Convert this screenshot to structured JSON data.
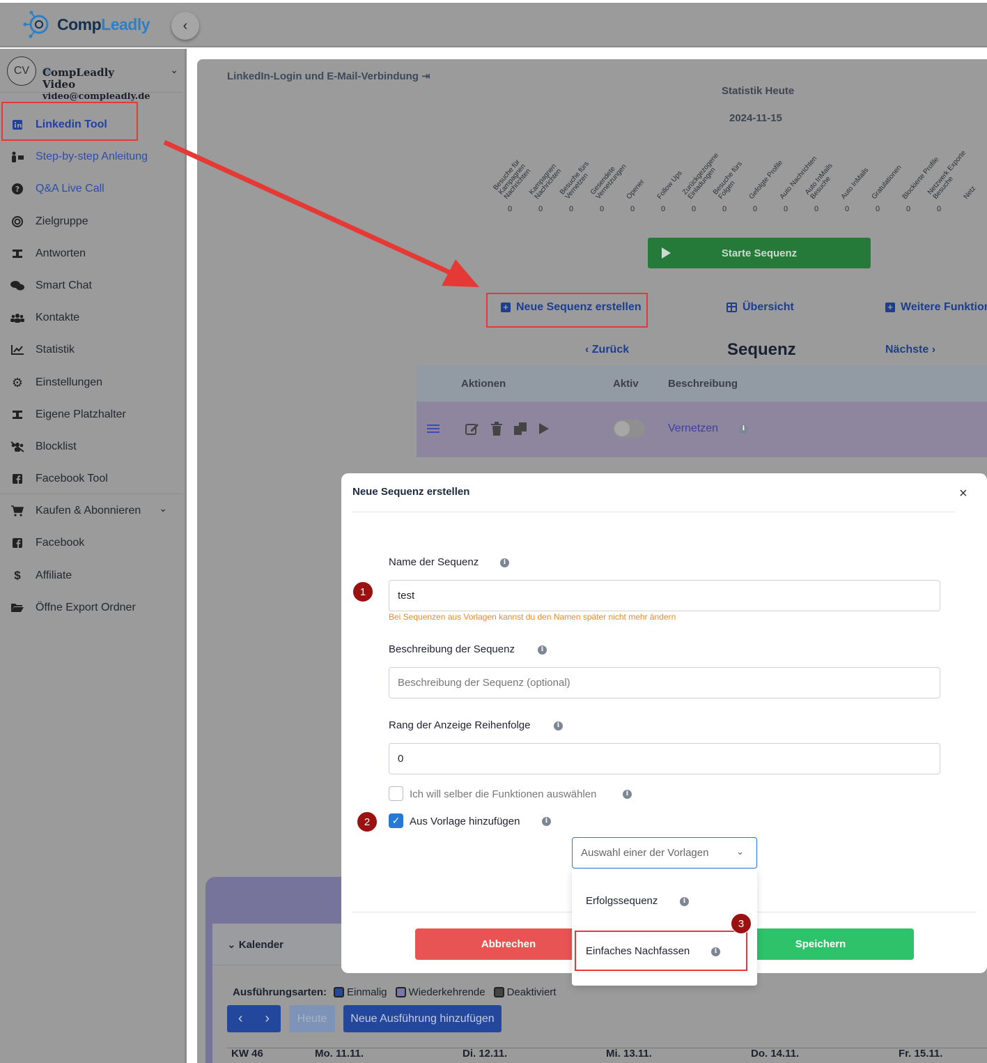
{
  "brand": {
    "name_part1": "Comp",
    "name_part2": "Leadly",
    "collapse_icon": "chevron-left-icon"
  },
  "user": {
    "initials": "CV",
    "name": "CompLeadly Video",
    "email": "video@compleadly.de"
  },
  "sidebar": {
    "items": [
      {
        "label": "Linkedin Tool",
        "icon": "linkedin-icon"
      },
      {
        "label": "Step-by-step Anleitung",
        "icon": "presenter-icon"
      },
      {
        "label": "Q&A Live Call",
        "icon": "question-icon"
      },
      {
        "label": "Zielgruppe",
        "icon": "target-icon"
      },
      {
        "label": "Antworten",
        "icon": "replies-icon"
      },
      {
        "label": "Smart Chat",
        "icon": "chat-icon"
      },
      {
        "label": "Kontakte",
        "icon": "users-icon"
      },
      {
        "label": "Statistik",
        "icon": "chart-icon"
      },
      {
        "label": "Einstellungen",
        "icon": "gear-icon"
      },
      {
        "label": "Eigene Platzhalter",
        "icon": "placeholder-icon"
      },
      {
        "label": "Blocklist",
        "icon": "block-users-icon"
      },
      {
        "label": "Facebook Tool",
        "icon": "facebook-icon"
      },
      {
        "label": "Kaufen & Abonnieren",
        "icon": "cart-icon"
      },
      {
        "label": "Facebook",
        "icon": "facebook-icon"
      },
      {
        "label": "Affiliate",
        "icon": "dollar-icon"
      },
      {
        "label": "Öffne Export Ordner",
        "icon": "folder-icon"
      }
    ]
  },
  "main": {
    "login_link": "LinkedIn-Login und E-Mail-Verbindung",
    "stat_title": "Statistik Heute",
    "stat_date": "2024-11-15",
    "stats": [
      {
        "label": [
          "Besuche für",
          "Kampagnen",
          "Nachrichten"
        ],
        "value": "0"
      },
      {
        "label": [
          "Kampagnen",
          "Nachrichten"
        ],
        "value": "0"
      },
      {
        "label": [
          "Besuche fürs",
          "Vernetzen"
        ],
        "value": "0"
      },
      {
        "label": [
          "Gesendete",
          "Vernetzungen"
        ],
        "value": "0"
      },
      {
        "label": [
          "Opener"
        ],
        "value": "0"
      },
      {
        "label": [
          "Follow Ups"
        ],
        "value": "0"
      },
      {
        "label": [
          "Zurückgezogene",
          "Einladungen"
        ],
        "value": "0"
      },
      {
        "label": [
          "Besuche fürs",
          "Folgen"
        ],
        "value": "0"
      },
      {
        "label": [
          "Gefolgte Profile"
        ],
        "value": "0"
      },
      {
        "label": [
          "Auto Nachrichten"
        ],
        "value": "0"
      },
      {
        "label": [
          "Auto InMails",
          "Besuche"
        ],
        "value": "0"
      },
      {
        "label": [
          "Auto InMails"
        ],
        "value": "0"
      },
      {
        "label": [
          "Gratulationen"
        ],
        "value": "0"
      },
      {
        "label": [
          "Blockierte Profile"
        ],
        "value": "0"
      },
      {
        "label": [
          "Netzwerk Exporte",
          "Besuche"
        ],
        "value": "0"
      },
      {
        "label": [
          "Netz"
        ],
        "value": ""
      }
    ],
    "start_button": "Starte Sequenz",
    "new_sequence": "Neue Sequenz erstellen",
    "overview": "Übersicht",
    "more_functions": "Weitere Funktion",
    "back": "Zurück",
    "next": "Nächste",
    "sequence_title": "Sequenz",
    "table_headers": {
      "actions": "Aktionen",
      "active": "Aktiv",
      "description": "Beschreibung"
    },
    "row": {
      "description": "Vernetzen"
    },
    "calendar": {
      "title": "Kalender",
      "arten_label": "Ausführungsarten:",
      "arten": [
        "Einmalig",
        "Wiederkehrende",
        "Deaktiviert"
      ],
      "today": "Heute",
      "add": "Neue Ausführung hinzufügen",
      "week": "KW 46",
      "days": [
        "Mo. 11.11.",
        "Di. 12.11.",
        "Mi. 13.11.",
        "Do. 14.11.",
        "Fr. 15.11."
      ]
    }
  },
  "modal": {
    "title": "Neue Sequenz erstellen",
    "close": "×",
    "name_label": "Name der Sequenz",
    "name_value": "test",
    "name_hint": "Bei Sequenzen aus Vorlagen kannst du den Namen später nicht mehr ändern",
    "desc_label": "Beschreibung der Sequenz",
    "desc_placeholder": "Beschreibung der Sequenz (optional)",
    "rank_label": "Rang der Anzeige Reihenfolge",
    "rank_value": "0",
    "custom_functions": "Ich will selber die Funktionen auswählen",
    "from_template": "Aus Vorlage hinzufügen",
    "template_placeholder": "Auswahl einer der Vorlagen",
    "options": [
      "Erfolgssequenz",
      "Einfaches Nachfassen"
    ],
    "cancel": "Abbrechen",
    "save": "Speichern",
    "steps": [
      "1",
      "2",
      "3"
    ]
  },
  "colors": {
    "accent": "#2878d6",
    "danger": "#e85454",
    "success": "#2ec26a",
    "annotation": "#e53935"
  }
}
